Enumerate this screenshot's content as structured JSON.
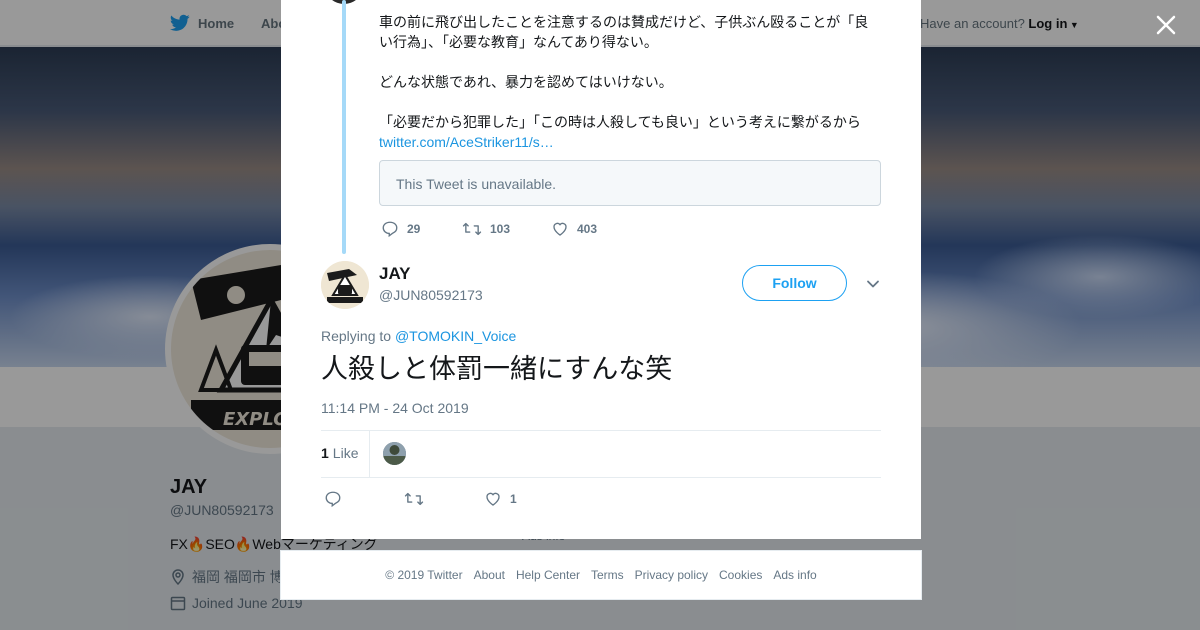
{
  "background": {
    "nav": {
      "home_label": "Home",
      "about_label": "About",
      "account_prompt": "Have an account?",
      "login_label": "Log in"
    },
    "profile": {
      "name": "JAY",
      "handle": "@JUN80592173",
      "bio": "FX🔥SEO🔥Webマーケティング",
      "location": "福岡 福岡市 博多区",
      "joined": "Joined June 2019",
      "avatar_text": "EXPLORE"
    },
    "ads_info": "Ads info"
  },
  "parent_tweet": {
    "paragraphs": [
      "車の前に飛び出したことを注意するのは賛成だけど、子供ぶん殴ることが「良い行為」、「必要な教育」なんてあり得ない。",
      "どんな状態であれ、暴力を認めてはいけない。",
      "「必要だから犯罪した」「この時は人殺しても良い」という考えに繋がるから"
    ],
    "link": "twitter.com/AceStriker11/s…",
    "quote_unavailable": "This Tweet is unavailable.",
    "reply_count": "29",
    "retweet_count": "103",
    "like_count": "403"
  },
  "tweet": {
    "author_name": "JAY",
    "author_handle": "@JUN80592173",
    "follow_label": "Follow",
    "replying_prefix": "Replying to",
    "replying_to": "@TOMOKIN_Voice",
    "text": "人殺しと体罰一緒にすんな笑",
    "timestamp": "11:14 PM - 24 Oct 2019",
    "likes_number": "1",
    "likes_label": "Like",
    "action_like_count": "1"
  },
  "footer": {
    "links": [
      "© 2019 Twitter",
      "About",
      "Help Center",
      "Terms",
      "Privacy policy",
      "Cookies",
      "Ads info"
    ]
  },
  "colors": {
    "twitter_blue": "#1da1f2",
    "link_blue": "#1b95e0",
    "thread_line": "#a5d9f8",
    "muted_text": "#657786"
  }
}
